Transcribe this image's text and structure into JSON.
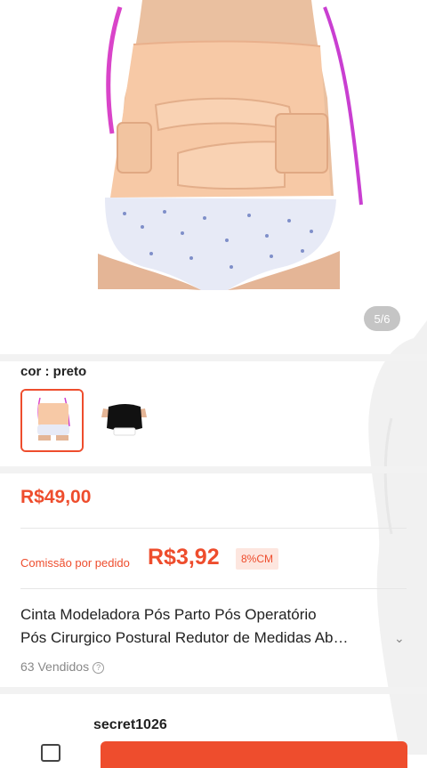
{
  "gallery": {
    "image_counter": "5/6",
    "image_subject": "product-photo-postpartum-belt"
  },
  "variation": {
    "label": "cor : preto",
    "options": [
      {
        "name": "bege",
        "selected": true
      },
      {
        "name": "preto",
        "selected": false
      }
    ]
  },
  "pricing": {
    "price": "R$49,00",
    "commission_label": "Comissão por pedido",
    "commission_value": "R$3,92",
    "commission_badge": "8%CM"
  },
  "product": {
    "title_line1": "Cinta Modeladora Pós Parto Pós Operatório",
    "title_line2": "Pós Cirurgico Postural Redutor de Medidas Ab…",
    "sold": "63 Vendidos",
    "help_icon": "?"
  },
  "seller": {
    "name": "secret1026"
  },
  "colors": {
    "accent": "#ee4d2d",
    "badge_bg": "#fde6df",
    "divider": "#f2f2f2"
  }
}
